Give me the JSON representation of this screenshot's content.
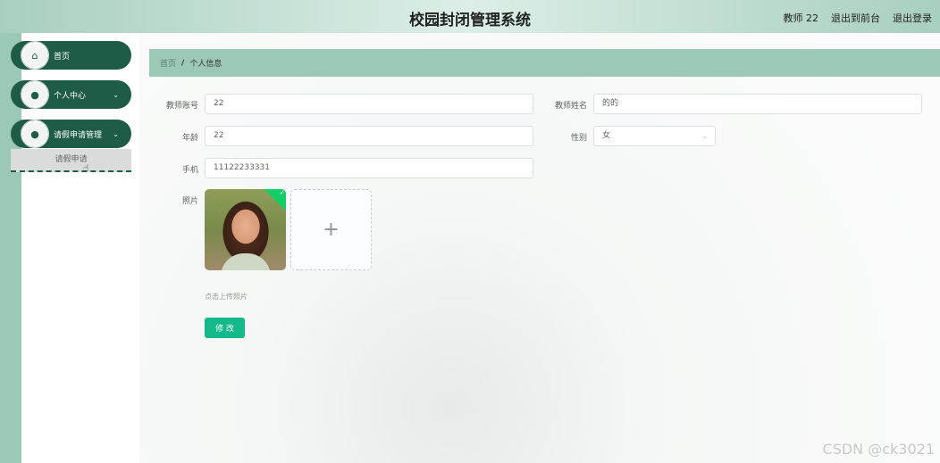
{
  "header": {
    "title": "校园封闭管理系统",
    "user": "教师 22",
    "back_to_front": "退出到前台",
    "logout": "退出登录"
  },
  "sidebar": {
    "items": [
      {
        "label": "首页",
        "icon": "home-icon"
      },
      {
        "label": "个人中心",
        "icon": "user-icon"
      },
      {
        "label": "请假申请管理",
        "icon": "user-icon"
      }
    ],
    "submenu": {
      "label": "请假申请"
    }
  },
  "breadcrumb": {
    "home": "首页",
    "separator": "/",
    "current": "个人信息"
  },
  "form": {
    "account_label": "教师账号",
    "account_value": "22",
    "name_label": "教师姓名",
    "name_value": "的的",
    "age_label": "年龄",
    "age_value": "22",
    "gender_label": "性别",
    "gender_value": "女",
    "phone_label": "手机",
    "phone_value": "11122233331",
    "photo_label": "照片",
    "upload_tip": "点击上传照片",
    "modify_label": "修 改"
  },
  "watermark": "CSDN @ck3021",
  "colors": {
    "primary": "#1f5c48",
    "accent": "#9cc8b6",
    "button": "#13b98a"
  }
}
